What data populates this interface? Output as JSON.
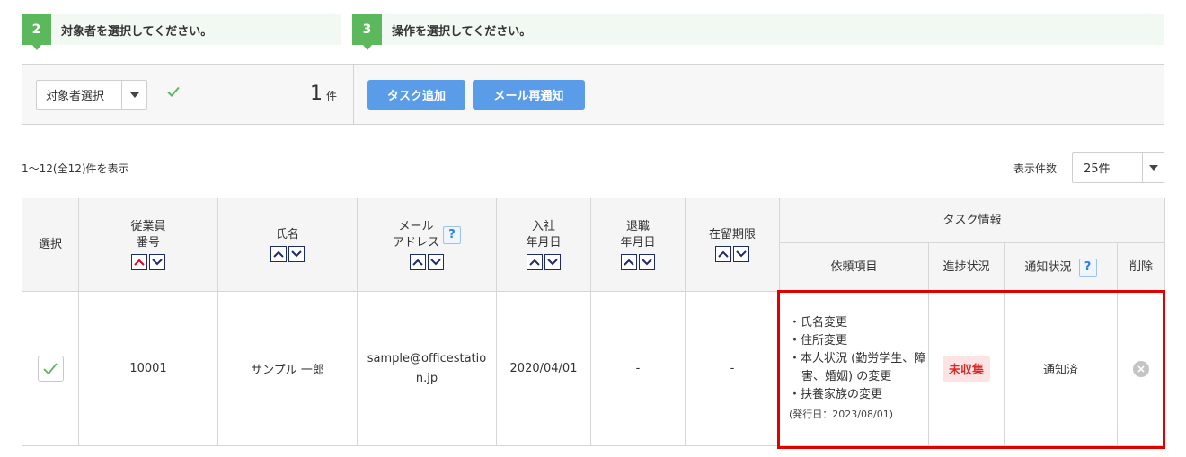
{
  "steps": [
    {
      "number": "2",
      "text": "対象者を選択してください。"
    },
    {
      "number": "3",
      "text": "操作を選択してください。"
    }
  ],
  "toolbar": {
    "target_select_label": "対象者選択",
    "count_number": "1",
    "count_unit": "件",
    "add_task_label": "タスク追加",
    "resend_mail_label": "メール再通知"
  },
  "list_info": {
    "range_text": "1〜12(全12)件を表示",
    "per_page_label": "表示件数",
    "per_page_value": "25件"
  },
  "table": {
    "headers": {
      "select": "選択",
      "employee_no_line1": "従業員",
      "employee_no_line2": "番号",
      "name": "氏名",
      "email_line1": "メール",
      "email_line2": "アドレス",
      "hire_line1": "入社",
      "hire_line2": "年月日",
      "retire_line1": "退職",
      "retire_line2": "年月日",
      "residence_limit": "在留期限",
      "task_info": "タスク情報",
      "request_items": "依頼項目",
      "progress": "進捗状況",
      "notify_status": "通知状況",
      "delete": "削除"
    },
    "help_glyph": "?",
    "rows": [
      {
        "employee_no": "10001",
        "name": "サンプル 一郎",
        "email": "sample@officestation.jp",
        "hire_date": "2020/04/01",
        "retire_date": "-",
        "residence_limit": "-",
        "request_items": [
          "・氏名変更",
          "・住所変更",
          "・本人状況 (勤労学生、障害、婚姻) の変更",
          "・扶養家族の変更"
        ],
        "issued": "(発行日：2023/08/01)",
        "progress": "未収集",
        "notify_status": "通知済"
      }
    ]
  },
  "colors": {
    "step_green": "#5cb85c",
    "button_blue": "#5b9ce8",
    "badge_red": "#d62b2b",
    "highlight_red": "#e10000",
    "sort_navy": "#1f2a6b",
    "sort_active_red": "#e0001b"
  },
  "icons": {
    "check": "check-icon",
    "sort_up": "chevron-up-icon",
    "sort_down": "chevron-down-icon",
    "help": "question-icon",
    "delete": "close-circle-icon"
  }
}
